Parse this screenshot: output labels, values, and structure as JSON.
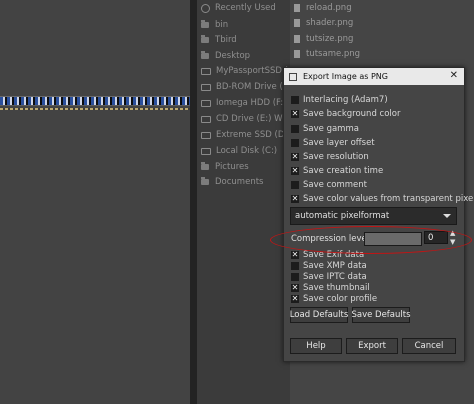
{
  "places": [
    {
      "label": "Recently Used",
      "icon": "clock-icon"
    },
    {
      "label": "bin",
      "icon": "folder-icon"
    },
    {
      "label": "Tbird",
      "icon": "folder-icon"
    },
    {
      "label": "Desktop",
      "icon": "folder-icon"
    },
    {
      "label": "MyPassportSSD (G:)",
      "icon": "drive-icon"
    },
    {
      "label": "BD-ROM Drive (E:)",
      "icon": "drive-icon"
    },
    {
      "label": "Iomega HDD (F:)",
      "icon": "drive-icon"
    },
    {
      "label": "CD Drive (E:) WD Unlocker",
      "icon": "drive-icon"
    },
    {
      "label": "Extreme SSD (D:)",
      "icon": "drive-icon"
    },
    {
      "label": "Local Disk (C:)",
      "icon": "drive-icon"
    },
    {
      "label": "Pictures",
      "icon": "folder-icon"
    },
    {
      "label": "Documents",
      "icon": "folder-icon"
    }
  ],
  "files": [
    "reload.png",
    "shader.png",
    "tutsize.png",
    "tutsame.png"
  ],
  "dialog": {
    "title": "Export Image as PNG",
    "options_top": [
      {
        "label": "Interlacing (Adam7)",
        "checked": false
      },
      {
        "label": "Save background color",
        "checked": true
      },
      {
        "label": "Save gamma",
        "checked": false
      },
      {
        "label": "Save layer offset",
        "checked": false
      },
      {
        "label": "Save resolution",
        "checked": true
      },
      {
        "label": "Save creation time",
        "checked": true
      },
      {
        "label": "Save comment",
        "checked": false
      },
      {
        "label": "Save color values from transparent pixels",
        "checked": true
      }
    ],
    "pixel_format": "automatic pixelformat",
    "compression_label": "Compression level:",
    "compression_value": "0",
    "options_bottom": [
      {
        "label": "Save Exif data",
        "checked": true
      },
      {
        "label": "Save XMP data",
        "checked": false
      },
      {
        "label": "Save IPTC data",
        "checked": false
      },
      {
        "label": "Save thumbnail",
        "checked": true
      },
      {
        "label": "Save color profile",
        "checked": true
      }
    ],
    "load_defaults": "Load Defaults",
    "save_defaults": "Save Defaults",
    "help": "Help",
    "export": "Export",
    "cancel": "Cancel"
  }
}
